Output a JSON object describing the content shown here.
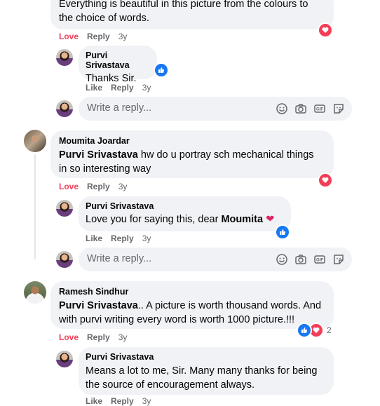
{
  "colors": {
    "bubble": "#f0f2f5",
    "love": "#f33e58",
    "like": "#1877f2",
    "meta": "#65676b"
  },
  "c0": {
    "text_line1": "Everything is beautiful in this picture from the colours to",
    "text_line2": "the choice of words.",
    "love": "Love",
    "reply": "Reply",
    "time": "3y"
  },
  "r0": {
    "author": "Purvi Srivastava",
    "text": "Thanks Sir.",
    "like": "Like",
    "reply": "Reply",
    "time": "3y"
  },
  "write1": {
    "placeholder": "Write a reply..."
  },
  "c1": {
    "author": "Moumita Joardar",
    "mention": "Purvi Srivastava",
    "text_after_mention": " hw do u portray sch mechanical things",
    "text_line2": "in so interesting way",
    "love": "Love",
    "reply": "Reply",
    "time": "3y"
  },
  "r1": {
    "author": "Purvi Srivastava",
    "text_before": "Love you for saying this, dear ",
    "mention": "Moumita",
    "emoji": "❤",
    "like": "Like",
    "reply": "Reply",
    "time": "3y"
  },
  "write2": {
    "placeholder": "Write a reply..."
  },
  "c2": {
    "author": "Ramesh Sindhur",
    "mention": "Purvi Srivastava",
    "text_after_mention": ".. A picture is worth thousand words. And",
    "text_line2": "with purvi writing every word is worth 1000 picture.!!!",
    "reaction_count": "2",
    "love": "Love",
    "reply": "Reply",
    "time": "3y"
  },
  "r2": {
    "author": "Purvi Srivastava",
    "text_line1": "Means a lot to me, Sir. Many many thanks for being",
    "text_line2": "the source of encouragement always.",
    "like": "Like",
    "reply": "Reply",
    "time": "3y"
  }
}
